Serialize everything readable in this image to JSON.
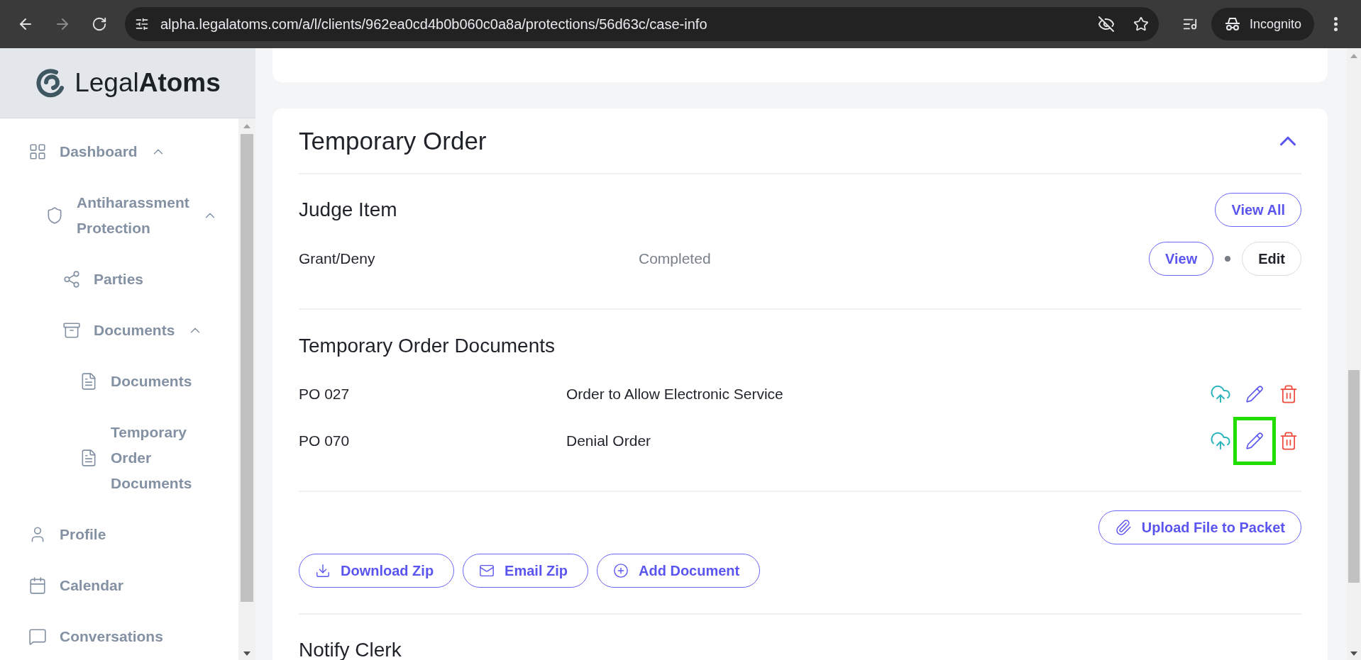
{
  "browser": {
    "url": "alpha.legalatoms.com/a/l/clients/962ea0cd4b0b060c0a8a/protections/56d63c/case-info",
    "profile_label": "Incognito"
  },
  "sidebar": {
    "logo": "Legal**Atoms**",
    "items": [
      {
        "kind": "dashboard",
        "label": "Dashboard",
        "expanded": true,
        "children": [
          {
            "kind": "shield",
            "label": "Antiharassment Protection",
            "expanded": true,
            "children": [
              {
                "kind": "share",
                "label": "Parties"
              },
              {
                "kind": "archive",
                "label": "Documents",
                "expanded": true,
                "children": [
                  {
                    "kind": "file",
                    "label": "Documents"
                  },
                  {
                    "kind": "file",
                    "label": "Temporary Order Documents"
                  }
                ]
              }
            ]
          }
        ]
      },
      {
        "kind": "profile",
        "label": "Profile"
      },
      {
        "kind": "calendar",
        "label": "Calendar"
      },
      {
        "kind": "chat",
        "label": "Conversations"
      }
    ]
  },
  "section": {
    "title": "Temporary Order",
    "expanded": true
  },
  "judge_item": {
    "title": "Judge Item",
    "view_all": "View All",
    "rows": [
      {
        "name": "Grant/Deny",
        "status": "Completed",
        "view": "View",
        "edit": "Edit"
      }
    ]
  },
  "documents": {
    "title": "Temporary Order Documents",
    "rows": [
      {
        "code": "PO 027",
        "name": "Order to Allow Electronic Service",
        "highlighted": false
      },
      {
        "code": "PO 070",
        "name": "Denial Order",
        "highlighted": true
      }
    ],
    "upload": "Upload File to Packet",
    "actions": [
      {
        "kind": "download",
        "label": "Download Zip"
      },
      {
        "kind": "email",
        "label": "Email Zip"
      },
      {
        "kind": "add",
        "label": "Add Document"
      }
    ]
  },
  "next_section": {
    "title": "Notify Clerk"
  }
}
